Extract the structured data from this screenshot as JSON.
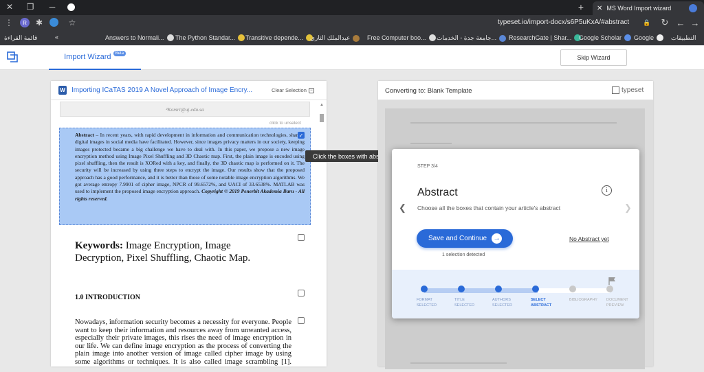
{
  "browser": {
    "tab_title": "MS Word Import wizard",
    "url": "typeset.io/import-docx/s6P5uKxA/#abstract",
    "profile_initial": "R",
    "bookmarks": [
      "التطبيقات",
      "Google",
      "Google Scholar",
      "ResearchGate | Shar...",
      "جامعة جدة - الخدمات...",
      "Free Computer boo...",
      "عبدالملك الثاري",
      "Transitive depende...",
      "The Python Standar...",
      "Answers to Normali..."
    ],
    "reading_list": "قائمة القراءة"
  },
  "app": {
    "tab_label": "Import Wizard",
    "beta": "Beta",
    "skip_label": "Skip Wizard"
  },
  "left": {
    "doc_title": "Importing ICaTAS 2019 A Novel Approach of Image Encry...",
    "clear_selection": "Clear Selection",
    "email": "²Komri@uj.edu.sa",
    "click_to_unselect": "click to unselect",
    "abstract_lead": "Abstract",
    "abstract_body": " – In recent years, with rapid development in information and communication technologies, sharing digital images in social media have facilitated. However, since images privacy matters in our society, keeping images protected became a big challenge we have to deal with. In this paper, we propose a new image encryption method using Image Pixel Shuffling and 3D Chaotic map. First, the plain image is encoded using pixel shuffling, then the result is XORed with a key, and finally, the 3D chaotic map is performed on it. The security will be increased by using three steps to encrypt the image. Our results show that the proposed approach has a good performance, and it is better than those of some notable image encryption algorithms. We got average entropy 7.9901 of cipher image, NPCR of 99.6572%, and UACI of 33.6538%. MATLAB was used to implement the proposed image encryption approach.",
    "abstract_copyright": "Copyright © 2019 Penerbit Akademia Baru - All rights reserved.",
    "keywords_lead": "Keywords:",
    "keywords_body": " Image Encryption, Image Decryption, Pixel Shuffling, Chaotic Map.",
    "intro_heading": "1.0 INTRODUCTION",
    "intro_para": "Nowadays, information security becomes a necessity for everyone. People want to keep their information and resources away from unwanted access, especially their private images, this rises the need of image encryption in our life. We can define image encryption as the process of converting the plain image into another version of image called cipher image by using some algorithms or techniques. It is also called image scrambling [1]. Image encryption is used for image content protection."
  },
  "tooltip": "Click the boxes with abstract",
  "right": {
    "title": "Converting to: Blank Template",
    "logo_text": "typeset"
  },
  "modal": {
    "step": "STEP 3/4",
    "title": "Abstract",
    "subtitle": "Choose all the boxes that contain your article's abstract",
    "save_label": "Save and Continue",
    "no_abstract": "No Abstract yet",
    "selection_detected": "1 selection detected",
    "steps": [
      {
        "label": "FORMAT SELECTED",
        "state": "done"
      },
      {
        "label": "TITLE SELECTED",
        "state": "done"
      },
      {
        "label": "AUTHORS SELECTED",
        "state": "done"
      },
      {
        "label": "SELECT ABSTRACT",
        "state": "current"
      },
      {
        "label": "BIBLIOGRAPHY",
        "state": "todo"
      },
      {
        "label": "DOCUMENT PREVIEW",
        "state": "todo"
      }
    ]
  },
  "colors": {
    "accent": "#2a6ad8",
    "selection": "#a9c9f5"
  }
}
